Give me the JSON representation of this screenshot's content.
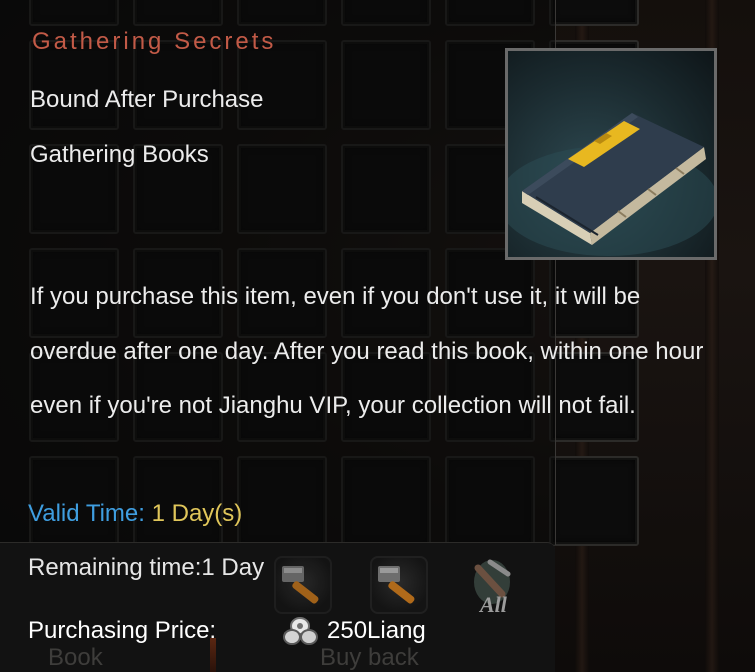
{
  "item": {
    "title": "Gathering Secrets",
    "bind_type": "Bound After Purchase",
    "category": "Gathering Books",
    "icon": "book-icon",
    "description": "If you purchase this item, even if you don't use it, it will be overdue after one day. After you read this book, within one hour even if you're not Jianghu VIP, your collection will not fail.",
    "valid_time_label": "Valid Time: ",
    "valid_time_value": "1 Day(s)",
    "remaining_time": "Remaining time:1 Day",
    "purchase_price_label": "Purchasing Price:",
    "purchase_price_value": "250Liang",
    "currency_icon": "silver-coin-icon"
  },
  "tools": {
    "hammer_icon_1": "hammer-icon",
    "hammer_icon_2": "hammer-icon",
    "all_label": "All"
  },
  "tabs": {
    "book_label": "Book",
    "buyback_label": "Buy back"
  },
  "colors": {
    "title": "#c25a47",
    "valid_time_label": "#3f9ee0",
    "valid_time_value": "#e0c65a",
    "text": "#ececec"
  }
}
